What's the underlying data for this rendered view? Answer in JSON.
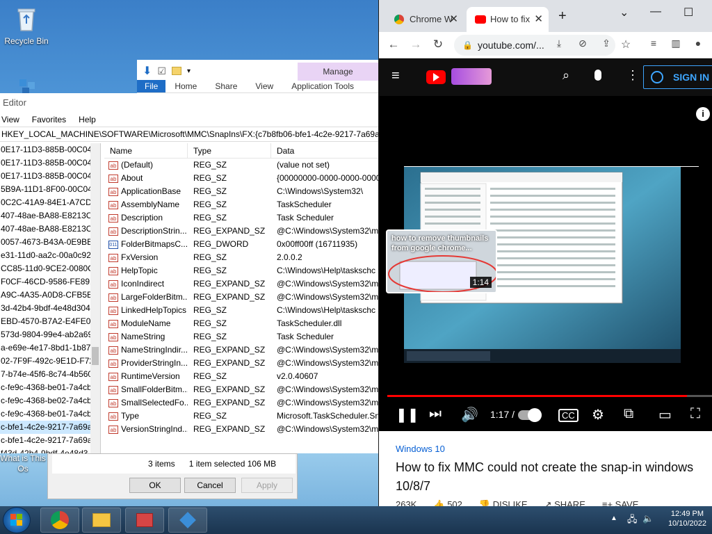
{
  "desktop": {
    "recycle_bin": "Recycle Bin",
    "what_is": "What is This Os"
  },
  "ribbon": {
    "manage": "Manage",
    "tabs": [
      "File",
      "Home",
      "Share",
      "View",
      "Application Tools"
    ]
  },
  "regedit": {
    "title": "Editor",
    "menu": [
      "View",
      "Favorites",
      "Help"
    ],
    "address": "HKEY_LOCAL_MACHINE\\SOFTWARE\\Microsoft\\MMC\\SnapIns\\FX:{c7b8fb06-bfe1-4c2e-9217-7a69a95bb",
    "tree": [
      "0E17-11D3-885B-00C04F",
      "0E17-11D3-885B-00C04F7",
      "0E17-11D3-885B-00C04F7",
      "5B9A-11D1-8F00-00C04F",
      "0C2C-41A9-84E1-A7CD1I",
      "407-48ae-BA88-E8213C6",
      "407-48ae-BA88-E8213C6",
      "0057-4673-B43A-0E9BBBI",
      "e31-11d0-aa2c-00a0c927",
      "CC85-11d0-9CE2-0080C7",
      "F0CF-46CD-9586-FE8912",
      "A9C-4A35-A0D8-CFB5EA",
      "3d-42b4-9bdf-4e48d304",
      "EBD-4570-B7A2-E4FE06A",
      "573d-9804-99e4-ab2a69",
      "a-e69e-4e17-8bd1-1b87b",
      "02-7F9F-492c-9E1D-F725",
      "7-b74e-45f6-8c74-4b560",
      "c-fe9c-4368-be01-7a4cb",
      "c-fe9c-4368-be02-7a4cb",
      "c-fe9c-4368-be01-7a4cb",
      "c-bfe1-4c2e-9217-7a69a",
      "c-bfe1-4c2e-9217-7a69a",
      "f43d-42b4-9bdf-4e48d3"
    ],
    "headers": {
      "name": "Name",
      "type": "Type",
      "data": "Data"
    },
    "values": [
      {
        "name": "(Default)",
        "type": "REG_SZ",
        "data": "(value not set)"
      },
      {
        "name": "About",
        "type": "REG_SZ",
        "data": "{00000000-0000-0000-0000-"
      },
      {
        "name": "ApplicationBase",
        "type": "REG_SZ",
        "data": "C:\\Windows\\System32\\"
      },
      {
        "name": "AssemblyName",
        "type": "REG_SZ",
        "data": "TaskScheduler"
      },
      {
        "name": "Description",
        "type": "REG_SZ",
        "data": "Task Scheduler"
      },
      {
        "name": "DescriptionStrin...",
        "type": "REG_EXPAND_SZ",
        "data": "@C:\\Windows\\System32\\m"
      },
      {
        "name": "FolderBitmapsC...",
        "type": "REG_DWORD",
        "data": "0x00ff00ff (16711935)"
      },
      {
        "name": "FxVersion",
        "type": "REG_SZ",
        "data": "2.0.0.2"
      },
      {
        "name": "HelpTopic",
        "type": "REG_SZ",
        "data": "C:\\Windows\\Help\\taskschc"
      },
      {
        "name": "IconIndirect",
        "type": "REG_EXPAND_SZ",
        "data": "@C:\\Windows\\System32\\m"
      },
      {
        "name": "LargeFolderBitm...",
        "type": "REG_EXPAND_SZ",
        "data": "@C:\\Windows\\System32\\m"
      },
      {
        "name": "LinkedHelpTopics",
        "type": "REG_SZ",
        "data": "C:\\Windows\\Help\\taskschc"
      },
      {
        "name": "ModuleName",
        "type": "REG_SZ",
        "data": "TaskScheduler.dll"
      },
      {
        "name": "NameString",
        "type": "REG_SZ",
        "data": "Task Scheduler"
      },
      {
        "name": "NameStringIndir...",
        "type": "REG_EXPAND_SZ",
        "data": "@C:\\Windows\\System32\\m"
      },
      {
        "name": "ProviderStringIn...",
        "type": "REG_EXPAND_SZ",
        "data": "@C:\\Windows\\System32\\m"
      },
      {
        "name": "RuntimeVersion",
        "type": "REG_SZ",
        "data": "v2.0.40607"
      },
      {
        "name": "SmallFolderBitm...",
        "type": "REG_EXPAND_SZ",
        "data": "@C:\\Windows\\System32\\m"
      },
      {
        "name": "SmallSelectedFo...",
        "type": "REG_EXPAND_SZ",
        "data": "@C:\\Windows\\System32\\m"
      },
      {
        "name": "Type",
        "type": "REG_SZ",
        "data": "Microsoft.TaskScheduler.Sn"
      },
      {
        "name": "VersionStringInd...",
        "type": "REG_EXPAND_SZ",
        "data": "@C:\\Windows\\System32\\m"
      }
    ]
  },
  "dialog": {
    "items": "3 items",
    "selected": "1 item selected  106 MB",
    "ok": "OK",
    "cancel": "Cancel",
    "apply": "Apply"
  },
  "chrome": {
    "tab1": "Chrome W",
    "tab2": "How to fix",
    "new_tab": "+",
    "url": "youtube.com/..."
  },
  "youtube": {
    "sign_in": "SIGN IN",
    "thumb_title": "how to remove thumbnails from google chrome...",
    "thumb_duration": "1:14",
    "timecode": "1:17 /",
    "progress": 0.92,
    "tag": "Windows 10",
    "title": "How to fix MMC could not create the snap-in windows 10/8/7",
    "views": "263K",
    "likes": "502",
    "dislike": "DISLIKE",
    "share": "SHARE",
    "save": "SAVE"
  },
  "taskbar": {
    "time": "12:49 PM",
    "date": "10/10/2022"
  },
  "colors": {
    "youtube_red": "#ff0000",
    "link_blue": "#065fd4",
    "signin_blue": "#3ea6ff"
  }
}
